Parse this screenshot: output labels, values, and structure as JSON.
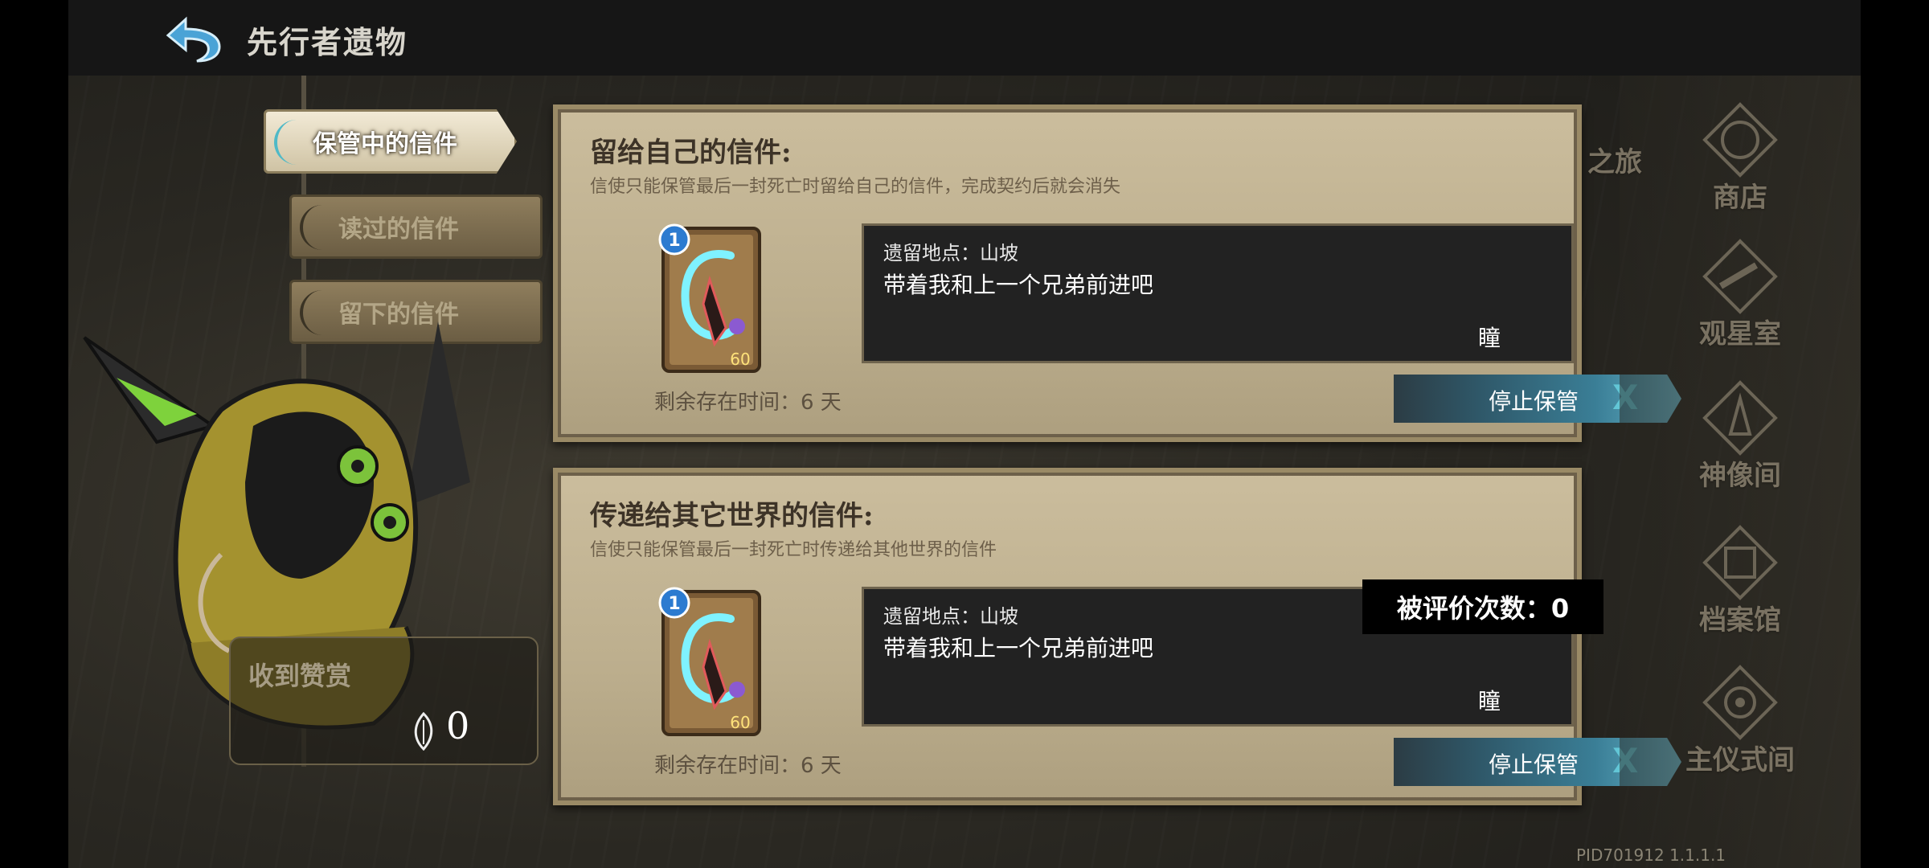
{
  "header": {
    "title": "先行者遗物"
  },
  "tabs": [
    {
      "label": "保管中的信件",
      "active": true
    },
    {
      "label": "读过的信件",
      "active": false
    },
    {
      "label": "留下的信件",
      "active": false
    }
  ],
  "reward": {
    "title": "收到赞赏",
    "count": "0"
  },
  "cards": [
    {
      "title": "留给自己的信件:",
      "description": "信使只能保管最后一封死亡时留给自己的信件，完成契约后就会消失",
      "letter": {
        "badge": "1",
        "level": "60"
      },
      "message": {
        "location": "遗留地点：山坡",
        "text": "带着我和上一个兄弟前进吧",
        "author": "瞳"
      },
      "remaining": "剩余存在时间：6 天",
      "button": {
        "label": "停止保管",
        "x": "X"
      }
    },
    {
      "title": "传递给其它世界的信件:",
      "description": "信使只能保管最后一封死亡时传递给其他世界的信件",
      "letter": {
        "badge": "1",
        "level": "60"
      },
      "message": {
        "location": "遗留地点：山坡",
        "text": "带着我和上一个兄弟前进吧",
        "author": "瞳"
      },
      "remaining": "剩余存在时间：6 天",
      "button": {
        "label": "停止保管",
        "x": "X"
      }
    }
  ],
  "rating": {
    "label": "被评价次数：0"
  },
  "right_nav": {
    "partial": "之旅",
    "items": [
      "商店",
      "观星室",
      "神像间",
      "档案馆",
      "主仪式间"
    ]
  },
  "footer": {
    "pid": "PID701912  1.1.1.1"
  },
  "colors": {
    "accent": "#4fb9c7",
    "parchment": "#c2b393",
    "button": "#3a7e96"
  }
}
